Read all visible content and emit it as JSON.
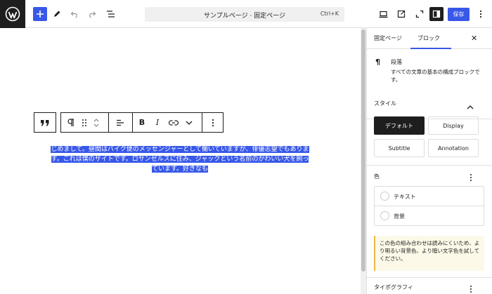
{
  "header": {
    "document_title": "サンプルページ · 固定ページ",
    "shortcut": "Ctrl+K",
    "save_label": "保存"
  },
  "editor": {
    "paragraph_text": "じめまして。昼間はバイク便のメッセンジャーとして働いていますが、俳優志望でもあります。これは僕のサイトです。ロサンゼルスに住み、ジャックという名前のかわいい犬を飼っています。好きなも",
    "block_toolbar": [
      "quote-icon",
      "paragraph-icon",
      "drag-icon",
      "move-icon",
      "align-icon",
      "bold-icon",
      "italic-icon",
      "link-icon",
      "chevron-down-icon",
      "more-options-icon"
    ]
  },
  "sidebar": {
    "tabs": [
      {
        "label": "固定ページ",
        "active": false
      },
      {
        "label": "ブロック",
        "active": true
      }
    ],
    "block": {
      "name": "段落",
      "description": "すべての文章の基本の構成ブロックです。"
    },
    "styles": {
      "title": "スタイル",
      "options": [
        {
          "label": "デフォルト",
          "active": true
        },
        {
          "label": "Display",
          "active": false
        },
        {
          "label": "Subtitle",
          "active": false
        },
        {
          "label": "Annotation",
          "active": false
        }
      ]
    },
    "color": {
      "title": "色",
      "items": [
        {
          "label": "テキスト"
        },
        {
          "label": "背景"
        }
      ],
      "notice": "この色の組み合わせは読みにくいため、より明るい背景色、より暗い文字色を試してください。"
    },
    "typography": {
      "title": "タイポグラフィ"
    }
  },
  "colors": {
    "accent": "#3858e9",
    "dark": "#1e1e1e",
    "notice_bg": "#fcf9e8",
    "notice_border": "#f0b849"
  }
}
